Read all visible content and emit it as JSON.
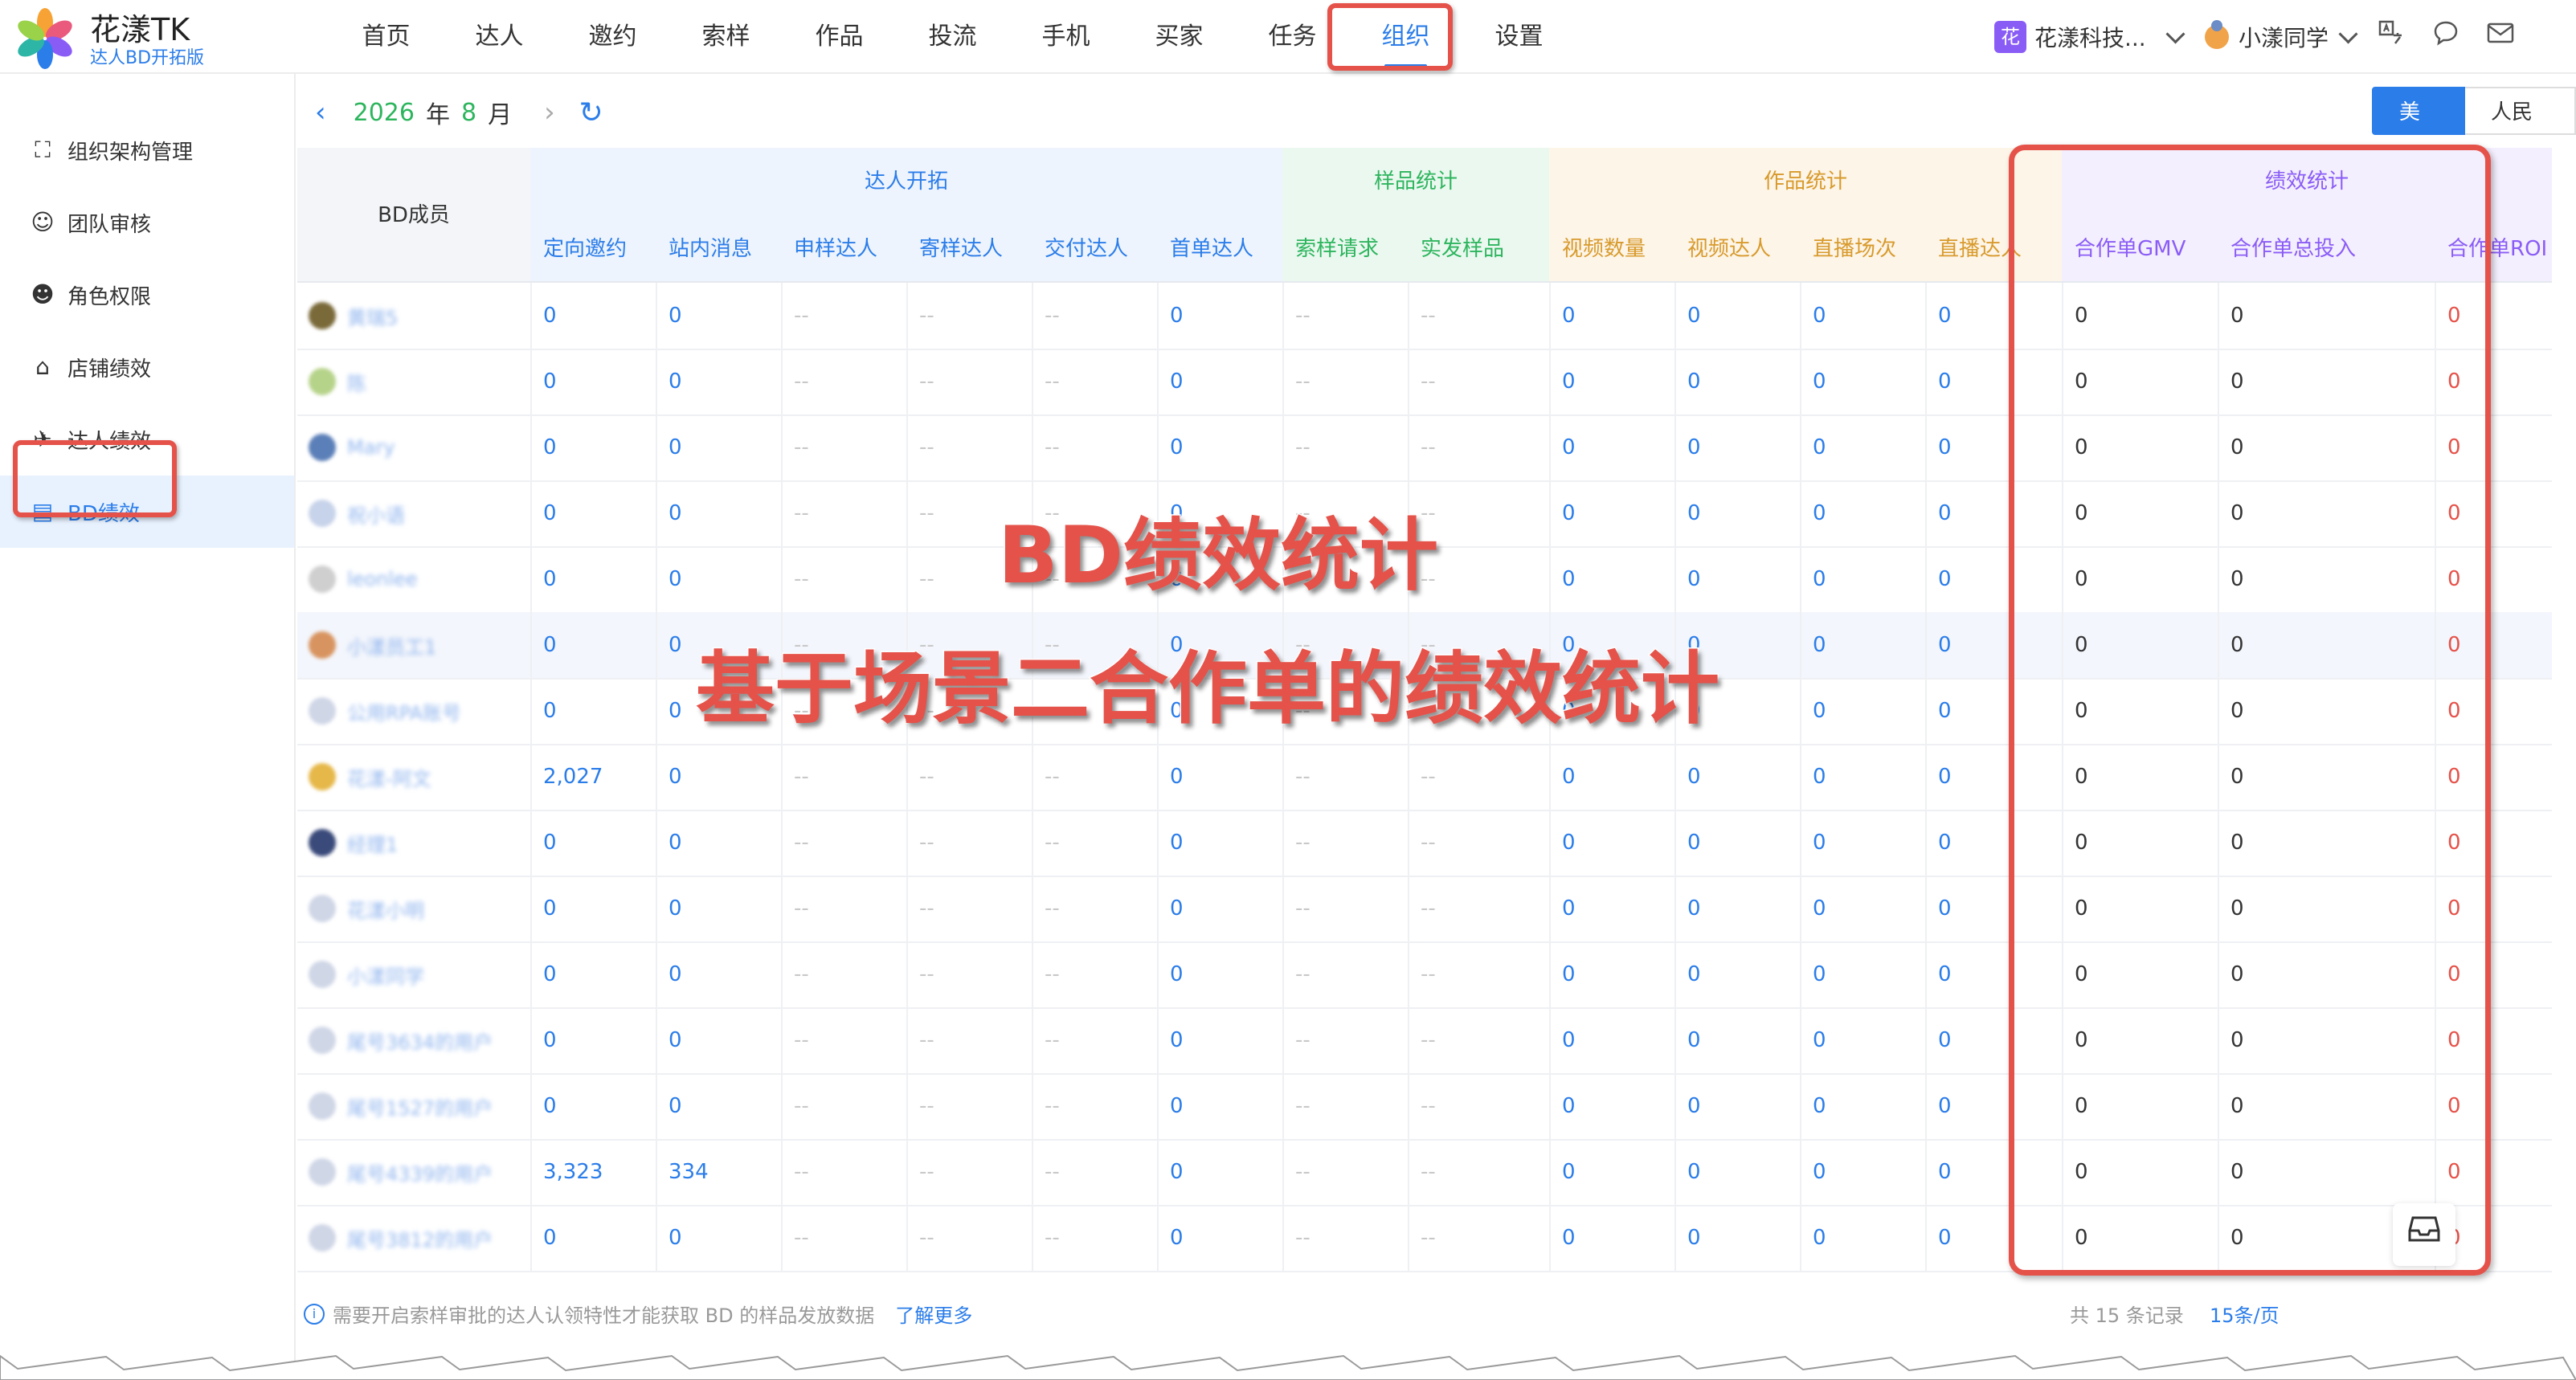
{
  "app": {
    "title": "花漾TK",
    "subtitle": "达人BD开拓版"
  },
  "nav": {
    "items": [
      "首页",
      "达人",
      "邀约",
      "索样",
      "作品",
      "投流",
      "手机",
      "买家",
      "任务",
      "组织",
      "设置"
    ],
    "active": "组织"
  },
  "header": {
    "org_badge": "花",
    "org_name": "花漾科技...",
    "user_name": "小漾同学"
  },
  "sidebar": {
    "items": [
      {
        "label": "组织架构管理",
        "icon": "org-tree-icon"
      },
      {
        "label": "团队审核",
        "icon": "user-check-icon"
      },
      {
        "label": "角色权限",
        "icon": "user-role-icon"
      },
      {
        "label": "店铺绩效",
        "icon": "store-icon"
      },
      {
        "label": "达人绩效",
        "icon": "creator-icon"
      },
      {
        "label": "BD绩效",
        "icon": "chart-icon"
      }
    ],
    "active": "BD绩效"
  },
  "datebar": {
    "year": "2026",
    "year_unit": "年",
    "month": "8",
    "month_unit": "月"
  },
  "currency": {
    "usd": "美元",
    "cny": "人民币"
  },
  "table": {
    "member_header": "BD成员",
    "groups": [
      {
        "label": "达人开拓",
        "color": "#2b7de9"
      },
      {
        "label": "样品统计",
        "color": "#2db55d"
      },
      {
        "label": "作品统计",
        "color": "#d89a2c"
      },
      {
        "label": "绩效统计",
        "color": "#8a5cf6"
      }
    ],
    "columns": [
      "定向邀约",
      "站内消息",
      "申样达人",
      "寄样达人",
      "交付达人",
      "首单达人",
      "索样请求",
      "实发样品",
      "视频数量",
      "视频达人",
      "直播场次",
      "直播达人",
      "合作单GMV",
      "合作单总投入",
      "合作单ROI"
    ],
    "rows": [
      {
        "name": "黄瑞5",
        "values": [
          "0",
          "0",
          "--",
          "--",
          "--",
          "0",
          "--",
          "--",
          "0",
          "0",
          "0",
          "0",
          "0",
          "0",
          "0"
        ]
      },
      {
        "name": "陈",
        "values": [
          "0",
          "0",
          "--",
          "--",
          "--",
          "0",
          "--",
          "--",
          "0",
          "0",
          "0",
          "0",
          "0",
          "0",
          "0"
        ]
      },
      {
        "name": "Mary",
        "values": [
          "0",
          "0",
          "--",
          "--",
          "--",
          "0",
          "--",
          "--",
          "0",
          "0",
          "0",
          "0",
          "0",
          "0",
          "0"
        ]
      },
      {
        "name": "祝小语",
        "values": [
          "0",
          "0",
          "--",
          "--",
          "--",
          "0",
          "--",
          "--",
          "0",
          "0",
          "0",
          "0",
          "0",
          "0",
          "0"
        ]
      },
      {
        "name": "leonlee",
        "values": [
          "0",
          "0",
          "--",
          "--",
          "--",
          "0",
          "--",
          "--",
          "0",
          "0",
          "0",
          "0",
          "0",
          "0",
          "0"
        ]
      },
      {
        "name": "小漾员工1",
        "values": [
          "0",
          "0",
          "--",
          "--",
          "--",
          "0",
          "--",
          "--",
          "0",
          "0",
          "0",
          "0",
          "0",
          "0",
          "0"
        ]
      },
      {
        "name": "公用RPA账号",
        "values": [
          "0",
          "0",
          "--",
          "--",
          "--",
          "0",
          "--",
          "--",
          "0",
          "0",
          "0",
          "0",
          "0",
          "0",
          "0"
        ]
      },
      {
        "name": "花漾-阿文",
        "values": [
          "2,027",
          "0",
          "--",
          "--",
          "--",
          "0",
          "--",
          "--",
          "0",
          "0",
          "0",
          "0",
          "0",
          "0",
          "0"
        ]
      },
      {
        "name": "经理1",
        "values": [
          "0",
          "0",
          "--",
          "--",
          "--",
          "0",
          "--",
          "--",
          "0",
          "0",
          "0",
          "0",
          "0",
          "0",
          "0"
        ]
      },
      {
        "name": "花漾小明",
        "values": [
          "0",
          "0",
          "--",
          "--",
          "--",
          "0",
          "--",
          "--",
          "0",
          "0",
          "0",
          "0",
          "0",
          "0",
          "0"
        ]
      },
      {
        "name": "小漾同学",
        "values": [
          "0",
          "0",
          "--",
          "--",
          "--",
          "0",
          "--",
          "--",
          "0",
          "0",
          "0",
          "0",
          "0",
          "0",
          "0"
        ]
      },
      {
        "name": "尾号3634的用户",
        "values": [
          "0",
          "0",
          "--",
          "--",
          "--",
          "0",
          "--",
          "--",
          "0",
          "0",
          "0",
          "0",
          "0",
          "0",
          "0"
        ]
      },
      {
        "name": "尾号1527的用户",
        "values": [
          "0",
          "0",
          "--",
          "--",
          "--",
          "0",
          "--",
          "--",
          "0",
          "0",
          "0",
          "0",
          "0",
          "0",
          "0"
        ]
      },
      {
        "name": "尾号4339的用户",
        "values": [
          "3,323",
          "334",
          "--",
          "--",
          "--",
          "0",
          "--",
          "--",
          "0",
          "0",
          "0",
          "0",
          "0",
          "0",
          "0"
        ]
      },
      {
        "name": "尾号3812的用户",
        "values": [
          "0",
          "0",
          "--",
          "--",
          "--",
          "0",
          "--",
          "--",
          "0",
          "0",
          "0",
          "0",
          "0",
          "0",
          "0"
        ]
      }
    ]
  },
  "annotations": {
    "line1": "BD绩效统计",
    "line2": "基于场景二合作单的绩效统计"
  },
  "footer": {
    "note": "需要开启索样审批的达人认领特性才能获取 BD 的样品发放数据",
    "learn_more": "了解更多",
    "total": "共 15 条记录",
    "page_size": "15条/页"
  },
  "colors": {
    "accent": "#2b7de9",
    "highlight": "#e5524a",
    "green": "#2db55d"
  }
}
